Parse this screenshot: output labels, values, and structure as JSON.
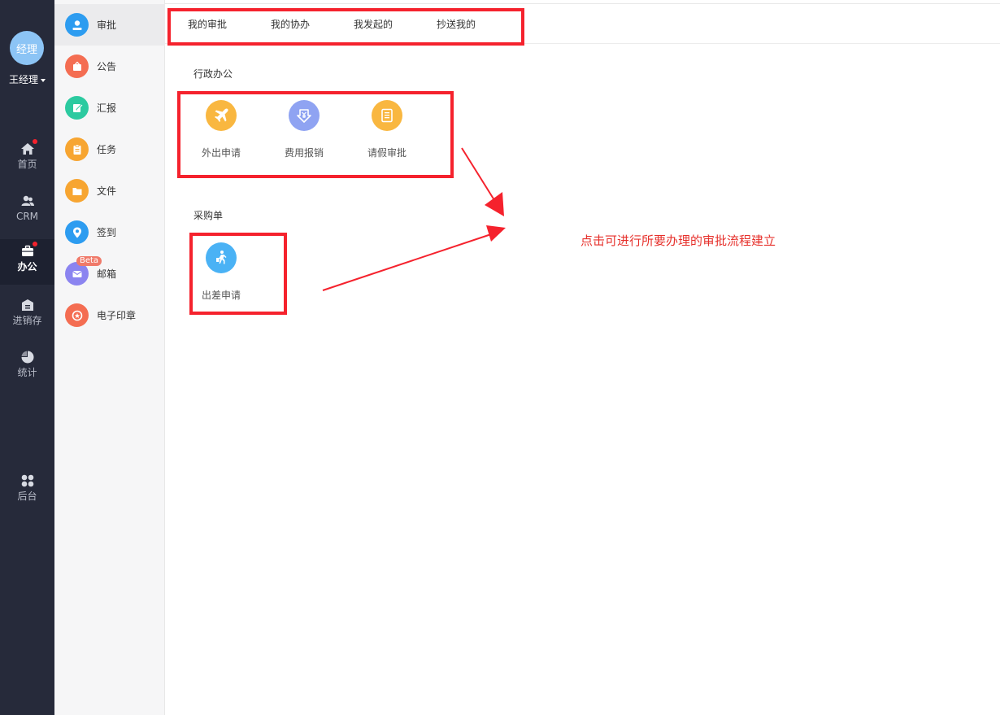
{
  "user": {
    "avatar_text": "经理",
    "name": "王经理"
  },
  "rail": {
    "items": [
      {
        "label": "首页",
        "icon": "home-icon",
        "badge": true
      },
      {
        "label": "CRM",
        "icon": "users-icon",
        "badge": false
      },
      {
        "label": "办公",
        "icon": "briefcase-icon",
        "badge": true,
        "active": true
      },
      {
        "label": "进销存",
        "icon": "warehouse-icon",
        "badge": false
      },
      {
        "label": "统计",
        "icon": "pie-chart-icon",
        "badge": false
      },
      {
        "label": "后台",
        "icon": "grid-icon",
        "badge": false
      }
    ]
  },
  "menu": {
    "items": [
      {
        "label": "审批",
        "icon": "approval-user-icon",
        "color": "#2d9cf0",
        "active": true
      },
      {
        "label": "公告",
        "icon": "announcement-icon",
        "color": "#f46d52"
      },
      {
        "label": "汇报",
        "icon": "report-edit-icon",
        "color": "#2ccaa0"
      },
      {
        "label": "任务",
        "icon": "clipboard-icon",
        "color": "#f7a531"
      },
      {
        "label": "文件",
        "icon": "folder-icon",
        "color": "#f7a531"
      },
      {
        "label": "签到",
        "icon": "location-pin-icon",
        "color": "#2d9cf0"
      },
      {
        "label": "邮箱",
        "icon": "mail-icon",
        "color": "#8b84f0",
        "badge": "Beta"
      },
      {
        "label": "电子印章",
        "icon": "seal-icon",
        "color": "#f46d52"
      }
    ]
  },
  "tabs": [
    {
      "label": "我的审批"
    },
    {
      "label": "我的协办"
    },
    {
      "label": "我发起的"
    },
    {
      "label": "抄送我的"
    }
  ],
  "sections": [
    {
      "title": "行政办公",
      "apps": [
        {
          "label": "外出申请",
          "icon": "plane-icon",
          "color": "#f9b740"
        },
        {
          "label": "费用报销",
          "icon": "expense-download-icon",
          "color": "#8fa3f2"
        },
        {
          "label": "请假审批",
          "icon": "document-icon",
          "color": "#f9b740"
        }
      ]
    },
    {
      "title": "采购单",
      "apps": [
        {
          "label": "出差申请",
          "icon": "walking-person-icon",
          "color": "#4ab2f5"
        }
      ]
    }
  ],
  "annotation": {
    "text": "点击可进行所要办理的审批流程建立"
  },
  "colors": {
    "highlight": "#f5222d",
    "annotation": "#e6302b",
    "rail_bg": "#262a3a"
  }
}
